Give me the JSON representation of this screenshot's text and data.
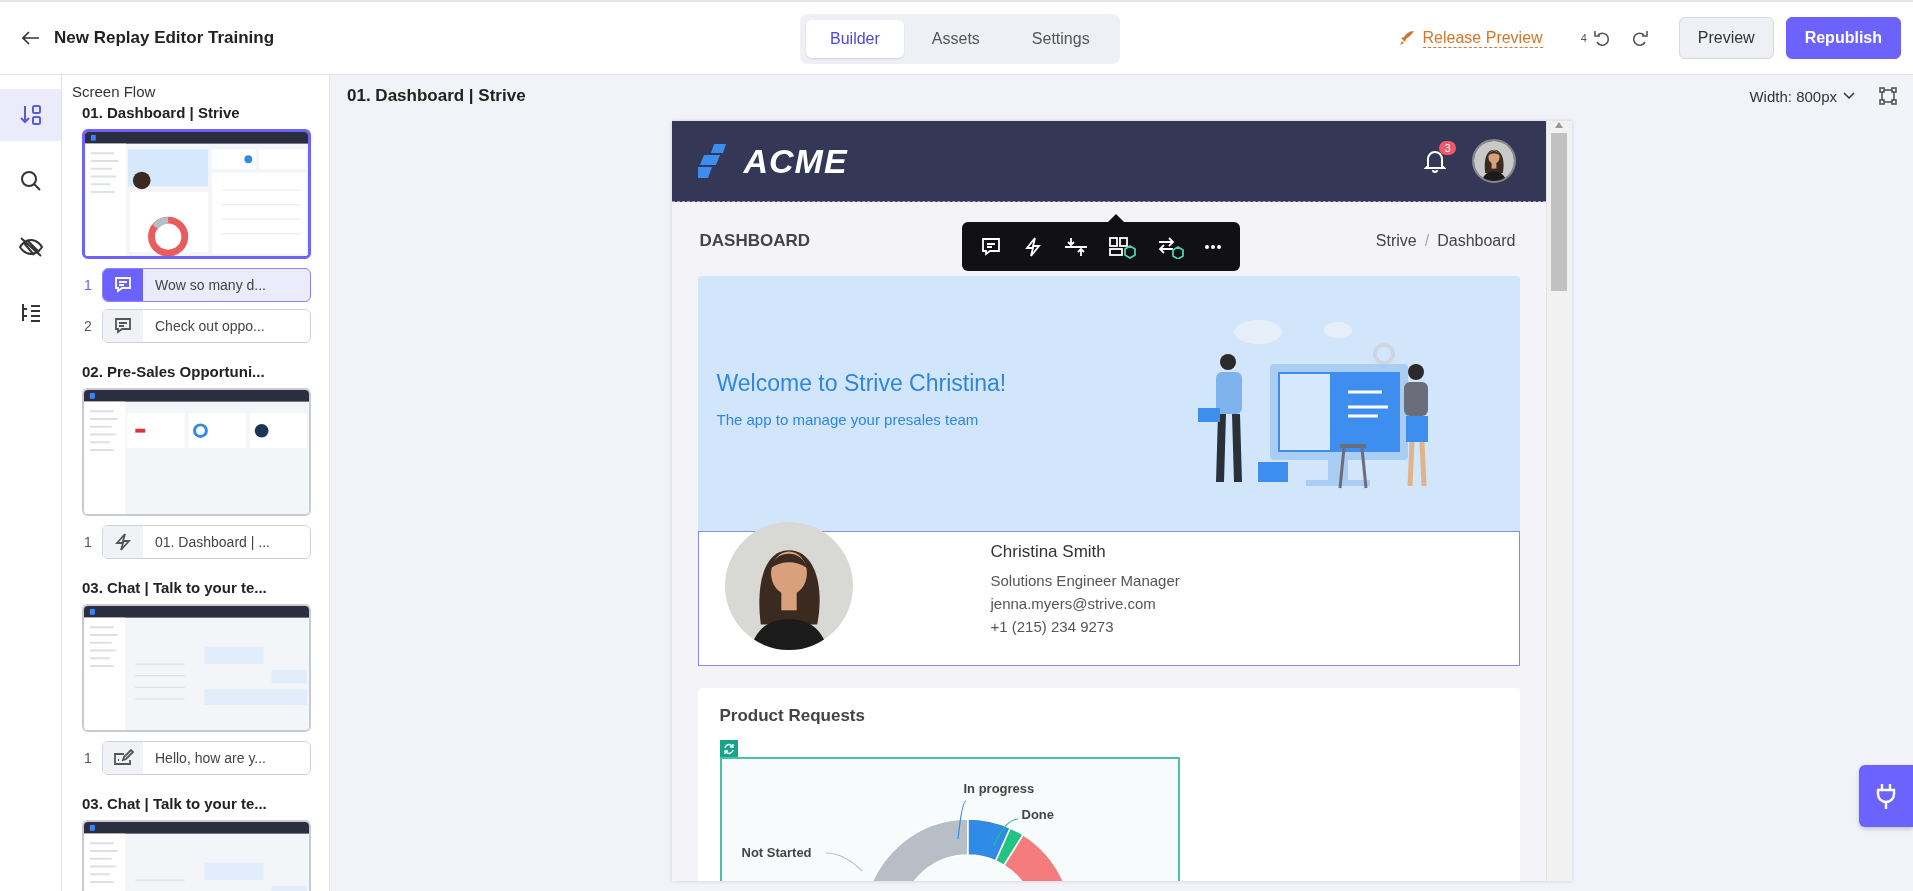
{
  "header": {
    "title": "New Replay Editor Training",
    "tabs": [
      {
        "label": "Builder",
        "selected": true
      },
      {
        "label": "Assets",
        "selected": false
      },
      {
        "label": "Settings",
        "selected": false
      }
    ],
    "release_preview": "Release Preview",
    "undo_count": "4",
    "buttons": [
      {
        "label": "Preview",
        "kind": "secondary"
      },
      {
        "label": "Republish",
        "kind": "primary"
      }
    ]
  },
  "rail": [
    {
      "kind": "flow",
      "selected": true
    },
    {
      "kind": "search",
      "selected": false
    },
    {
      "kind": "hidden",
      "selected": false
    },
    {
      "kind": "tree",
      "selected": false
    }
  ],
  "sidebar": {
    "title": "Screen Flow",
    "screens": [
      {
        "title": "01. Dashboard | Strive",
        "selected": true,
        "steps": [
          {
            "number": "1",
            "kind": "comment",
            "label": "Wow so many d...",
            "selected": true
          },
          {
            "number": "2",
            "kind": "comment",
            "label": "Check out oppo...",
            "selected": false
          }
        ]
      },
      {
        "title": "02. Pre-Sales Opportuni...",
        "selected": false,
        "steps": [
          {
            "number": "1",
            "kind": "trigger",
            "label": "01. Dashboard | ...",
            "selected": false
          }
        ]
      },
      {
        "title": "03. Chat | Talk to your te...",
        "selected": false,
        "steps": [
          {
            "number": "1",
            "kind": "input",
            "label": "Hello, how are y...",
            "selected": false
          }
        ]
      },
      {
        "title": "03. Chat | Talk to your te...",
        "selected": false
      }
    ]
  },
  "canvas": {
    "title": "01. Dashboard | Strive",
    "width_label": "Width: 800px"
  },
  "preview": {
    "logo": "ACME",
    "notifications": "3",
    "page_title": "DASHBOARD",
    "breadcrumb": [
      "Strive",
      "Dashboard"
    ],
    "breadcrumb_separator": "/",
    "toolbar": [
      {
        "kind": "comment"
      },
      {
        "kind": "trigger"
      },
      {
        "kind": "spacing"
      },
      {
        "kind": "layout"
      },
      {
        "kind": "swap"
      },
      {
        "kind": "more"
      }
    ],
    "welcome": {
      "title": "Welcome to Strive Christina!",
      "subtitle": "The app to manage your presales team"
    },
    "profile": {
      "name": "Christina Smith",
      "role": "Solutions Engineer Manager",
      "email": "jenna.myers@strive.com",
      "phone": "+1 (215) 234 9273",
      "selected": true
    },
    "requests": {
      "title": "Product Requests",
      "labels": [
        {
          "text": "In progress",
          "color": "#2f8be6"
        },
        {
          "text": "Done",
          "color": "#23c483"
        },
        {
          "text": "Not Started",
          "color": "#b7bec5"
        }
      ]
    }
  }
}
